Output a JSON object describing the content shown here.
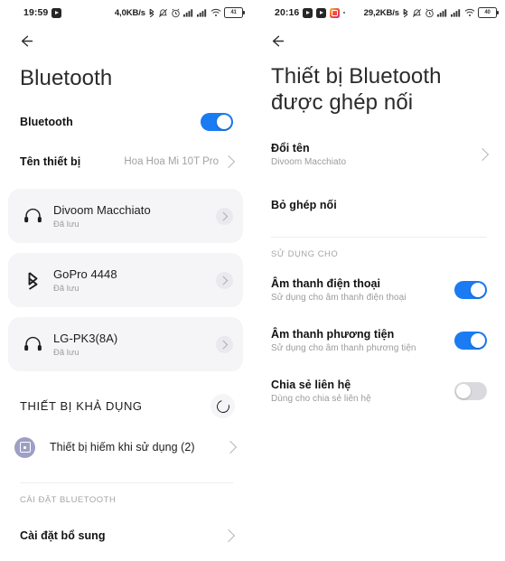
{
  "left": {
    "statusbar": {
      "time": "19:59",
      "apps": [
        "video-icon"
      ],
      "data_rate": "4,0KB/s",
      "icons": [
        "bluetooth-icon",
        "vibrate-off-icon",
        "alarm-icon",
        "signal-icon",
        "signal-icon",
        "wifi-icon"
      ],
      "battery_level": "41"
    },
    "back_label": "back-arrow",
    "title": "Bluetooth",
    "bluetooth_row": {
      "label": "Bluetooth",
      "enabled": true
    },
    "device_name_row": {
      "label": "Tên thiết bị",
      "value": "Hoa Hoa Mi 10T Pro"
    },
    "paired_devices": [
      {
        "name": "Divoom Macchiato",
        "status": "Đã lưu",
        "icon": "headphones-icon"
      },
      {
        "name": "GoPro 4448",
        "status": "Đã lưu",
        "icon": "bluetooth-icon"
      },
      {
        "name": "LG-PK3(8A)",
        "status": "Đã lưu",
        "icon": "headphones-icon"
      }
    ],
    "available_section": {
      "header": "THIẾT BỊ KHẢ DỤNG",
      "scanning": true
    },
    "unused_devices_row": {
      "label": "Thiết bị hiếm khi sử dụng (2)"
    },
    "settings_section": {
      "header": "CÀI ĐẶT BLUETOOTH",
      "item": "Cài đặt bổ sung"
    }
  },
  "right": {
    "statusbar": {
      "time": "20:16",
      "apps": [
        "video-icon",
        "video-icon",
        "instagram-icon",
        "dot-icon"
      ],
      "data_rate": "29,2KB/s",
      "icons": [
        "bluetooth-icon",
        "vibrate-off-icon",
        "alarm-icon",
        "signal-icon",
        "signal-icon",
        "wifi-icon"
      ],
      "battery_level": "40"
    },
    "back_label": "back-arrow",
    "title_line1": "Thiết bị Bluetooth",
    "title_line2": "được ghép nối",
    "rename_row": {
      "label": "Đổi tên",
      "value": "Divoom Macchiato"
    },
    "unpair_row": {
      "label": "Bỏ ghép nối"
    },
    "usage_section": {
      "header": "SỬ DỤNG CHO",
      "items": [
        {
          "title": "Âm thanh điện thoại",
          "subtitle": "Sử dụng cho âm thanh điện thoại",
          "enabled": true
        },
        {
          "title": "Âm thanh phương tiện",
          "subtitle": "Sử dụng cho âm thanh phương tiện",
          "enabled": true
        },
        {
          "title": "Chia sẻ liên hệ",
          "subtitle": "Dùng cho chia sẻ liên hệ",
          "enabled": false
        }
      ]
    }
  },
  "colors": {
    "accent": "#1a7bf2",
    "card": "#f5f5f7",
    "toggle_off": "#d9d9de",
    "unused_icon": "#9d9fc4"
  }
}
